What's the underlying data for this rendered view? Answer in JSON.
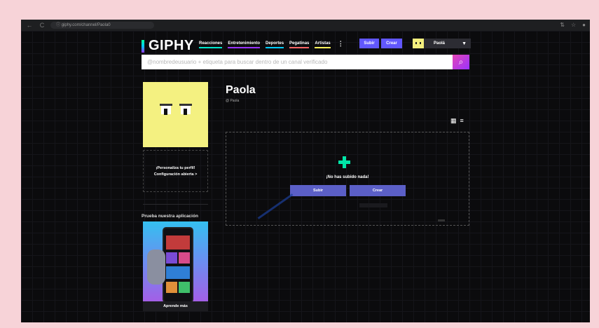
{
  "browser": {
    "url": "giphy.com/channel/Paola0",
    "back": "←",
    "forward": "→",
    "reload": "C",
    "lock": "ⓘ",
    "right_icons": [
      "⇅",
      "☆",
      "●"
    ]
  },
  "header": {
    "logo": "GIPHY",
    "nav": [
      "Reacciones",
      "Entretenimiento",
      "Deportes",
      "Pegatinas",
      "Artistas"
    ],
    "more": "⋮",
    "upload_label": "Subir",
    "create_label": "Crear",
    "user_name": "Paolá",
    "user_caret": "▼"
  },
  "search": {
    "placeholder": "@nombredeusuario + etiqueta para buscar dentro de un canal verificado",
    "icon": "⌕"
  },
  "sidebar": {
    "personalize": "¡Personaliza tu perfil!",
    "open_settings": "Configuración abierta  >",
    "app_label": "Prueba nuestra aplicación",
    "learn_more": "Aprende más"
  },
  "profile": {
    "name": "Paola",
    "handle": "@ Paola",
    "grid_icon": "▦",
    "list_icon": "≡"
  },
  "empty": {
    "message": "¡No has subido nada!",
    "upload_label": "Subir",
    "create_label": "Crear"
  }
}
